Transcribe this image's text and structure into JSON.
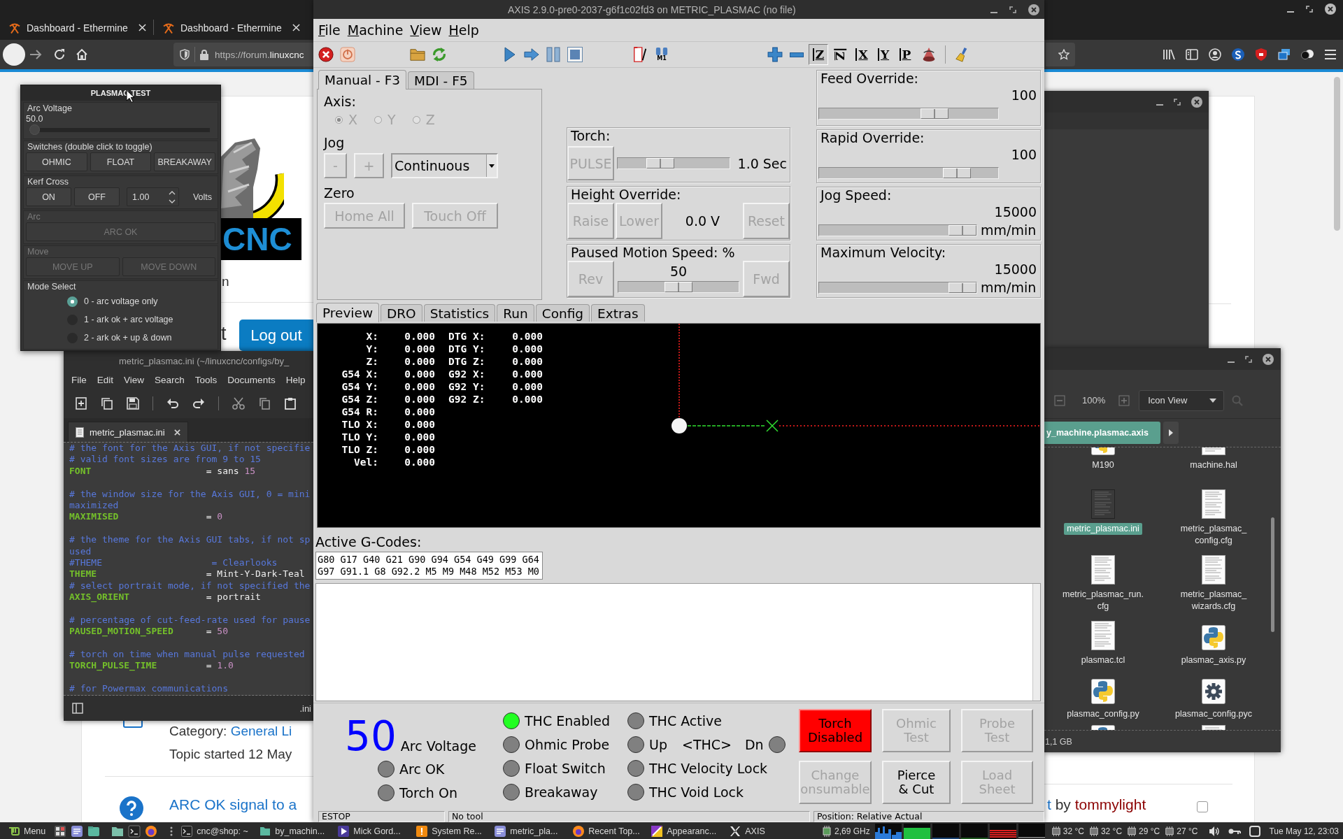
{
  "browser": {
    "tabs": [
      {
        "title": "Dashboard - Ethermine",
        "selected": false
      },
      {
        "title": "Dashboard - Ethermine",
        "selected": false
      }
    ],
    "url": {
      "prefix": "https://forum.",
      "domain": "linuxcnc"
    },
    "page": {
      "logo_text": "CNC",
      "fragment_upper": "n",
      "fragment_lower": "t",
      "logout": "Log out",
      "category_label": "Category:",
      "category_link": "General Li",
      "topic_started": "Topic started 12 May",
      "topic_link": "ARC OK signal to a",
      "author_link_end": "t",
      "author_by": "by",
      "author": "tommylight",
      "topic_checkbox": {
        "checked": false
      }
    }
  },
  "plasmac_test": {
    "title": "PLASMAC TEST",
    "groups": [
      {
        "kind": "slider",
        "label": "Arc Voltage",
        "disabled": false,
        "value": "50.0",
        "level": 0
      },
      {
        "kind": "buttons",
        "label": "Switches (double click to toggle)",
        "disabled": false,
        "buttons": [
          "OHMIC",
          "FLOAT",
          "BREAKAWAY"
        ]
      },
      {
        "kind": "spin",
        "label": "Kerf Cross",
        "disabled": false,
        "buttons": [
          "ON",
          "OFF"
        ],
        "value": "1.00",
        "unit": "Volts"
      },
      {
        "kind": "buttons",
        "label": "Arc",
        "disabled": true,
        "buttons": [
          "ARC OK"
        ]
      },
      {
        "kind": "buttons",
        "label": "Move",
        "disabled": true,
        "buttons": [
          "MOVE UP",
          "MOVE DOWN"
        ]
      },
      {
        "kind": "radios",
        "label": "Mode Select",
        "disabled": false,
        "options": [
          {
            "label": "0 - arc voltage only",
            "selected": true
          },
          {
            "label": "1 - ark ok + arc voltage",
            "selected": false
          },
          {
            "label": "2 - ark ok + up & down",
            "selected": false
          }
        ]
      }
    ]
  },
  "editor": {
    "title": "metric_plasmac.ini (~/linuxcnc/configs/by_",
    "menu": [
      "File",
      "Edit",
      "View",
      "Search",
      "Tools",
      "Documents",
      "Help"
    ],
    "tab": "metric_plasmac.ini",
    "lines": [
      {
        "kind": "comment",
        "text": "# the font for the Axis GUI, if not specifie"
      },
      {
        "kind": "comment",
        "text": "# valid font sizes are from 9 to 15"
      },
      {
        "kind": "setting",
        "key": "FONT",
        "tokens": [
          {
            "kind": "operator",
            "text": "="
          },
          {
            "kind": "string",
            "text": "sans"
          },
          {
            "kind": "number",
            "text": "15"
          }
        ]
      },
      {
        "kind": "blank"
      },
      {
        "kind": "comment",
        "text": "# the window size for the Axis GUI, 0 = mini"
      },
      {
        "kind": "comment",
        "text": "maximized"
      },
      {
        "kind": "setting",
        "key": "MAXIMISED",
        "tokens": [
          {
            "kind": "operator",
            "text": "="
          },
          {
            "kind": "number",
            "text": "0"
          }
        ]
      },
      {
        "kind": "blank"
      },
      {
        "kind": "comment",
        "text": "# the theme for the Axis GUI tabs, if not sp"
      },
      {
        "kind": "comment",
        "text": "used"
      },
      {
        "kind": "comment",
        "text": "#THEME                    = Clearlooks"
      },
      {
        "kind": "setting",
        "key": "THEME",
        "tokens": [
          {
            "kind": "operator",
            "text": "="
          },
          {
            "kind": "string",
            "text": "Mint-Y-Dark-Teal"
          }
        ]
      },
      {
        "kind": "comment",
        "text": "# select portrait mode, if not specified the"
      },
      {
        "kind": "setting",
        "key": "AXIS_ORIENT",
        "tokens": [
          {
            "kind": "operator",
            "text": "="
          },
          {
            "kind": "string",
            "text": "portrait"
          }
        ]
      },
      {
        "kind": "blank"
      },
      {
        "kind": "comment",
        "text": "# percentage of cut-feed-rate used for pause"
      },
      {
        "kind": "setting",
        "key": "PAUSED_MOTION_SPEED",
        "tokens": [
          {
            "kind": "operator",
            "text": "="
          },
          {
            "kind": "number",
            "text": "50"
          }
        ]
      },
      {
        "kind": "blank"
      },
      {
        "kind": "comment",
        "text": "# torch on time when manual pulse requested"
      },
      {
        "kind": "setting",
        "key": "TORCH_PULSE_TIME",
        "tokens": [
          {
            "kind": "operator",
            "text": "="
          },
          {
            "kind": "number",
            "text": "1.0"
          }
        ]
      },
      {
        "kind": "blank"
      },
      {
        "kind": "comment",
        "text": "# for Powermax communications"
      }
    ],
    "status": ".ini"
  },
  "file_manager": {
    "zoom": "100%",
    "view_mode": "Icon View",
    "path": "y_machine.plasmac.axis",
    "files_cut_above": [
      {
        "name_lines": [
          "M190"
        ],
        "kind": "python"
      },
      {
        "name_lines": [
          "machine.hal"
        ],
        "kind": "text"
      }
    ],
    "files": [
      {
        "name_lines": [
          "metric_plasmac.ini"
        ],
        "kind": "text",
        "selected": true
      },
      {
        "name_lines": [
          "metric_plasmac_",
          "config.cfg"
        ],
        "kind": "text",
        "selected": false
      },
      {
        "name_lines": [
          "metric_plasmac_run.",
          "cfg"
        ],
        "kind": "text",
        "selected": false
      },
      {
        "name_lines": [
          "metric_plasmac_",
          "wizards.cfg"
        ],
        "kind": "text",
        "selected": false
      },
      {
        "name_lines": [
          "plasmac.tcl"
        ],
        "kind": "text",
        "selected": false
      },
      {
        "name_lines": [
          "plasmac_axis.py"
        ],
        "kind": "python",
        "selected": false
      },
      {
        "name_lines": [
          "plasmac_config.py"
        ],
        "kind": "python",
        "selected": false
      },
      {
        "name_lines": [
          "plasmac_config.pyc"
        ],
        "kind": "gear",
        "selected": false
      }
    ],
    "files_cut_below": [
      {
        "kind": "python"
      },
      {
        "kind": "text"
      }
    ],
    "status": "1,1 GB"
  },
  "axis": {
    "title": "AXIS 2.9.0-pre0-2037-g6f1c02fd3 on METRIC_PLASMAC (no file)",
    "menu": [
      "File",
      "Machine",
      "View",
      "Help"
    ],
    "toolbar": [
      {
        "kind": "estop",
        "pressed": false
      },
      {
        "kind": "power",
        "pressed": false
      },
      {
        "kind": "open",
        "pressed": false
      },
      {
        "kind": "reload",
        "pressed": false
      },
      {
        "kind": "run",
        "pressed": false
      },
      {
        "kind": "step",
        "pressed": false
      },
      {
        "kind": "pause",
        "pressed": false
      },
      {
        "kind": "stop",
        "pressed": false
      },
      {
        "kind": "block-delete",
        "pressed": false
      },
      {
        "kind": "optional-stop",
        "pressed": false,
        "text": "M1"
      },
      {
        "kind": "zoom-in",
        "pressed": false
      },
      {
        "kind": "zoom-out",
        "pressed": false
      },
      {
        "kind": "view",
        "text": "Z",
        "pressed": true
      },
      {
        "kind": "view-rotated",
        "text": "Z",
        "pressed": false
      },
      {
        "kind": "view",
        "text": "X",
        "pressed": false
      },
      {
        "kind": "view",
        "text": "Y",
        "pressed": false
      },
      {
        "kind": "view",
        "text": "P",
        "pressed": false
      },
      {
        "kind": "rotate",
        "pressed": false
      },
      {
        "kind": "clear",
        "pressed": false
      }
    ],
    "control_tabs": [
      {
        "label": "Manual - F3",
        "selected": true
      },
      {
        "label": "MDI - F5",
        "selected": false
      }
    ],
    "axis_label": "Axis:",
    "axes_disabled": true,
    "axes": [
      {
        "label": "X",
        "selected": true
      },
      {
        "label": "Y",
        "selected": false
      },
      {
        "label": "Z",
        "selected": false
      }
    ],
    "jog_label": "Jog",
    "jog_buttons": [
      {
        "label": "-",
        "disabled": true
      },
      {
        "label": "+",
        "disabled": true
      }
    ],
    "jog_mode": "Continuous",
    "zero_label": "Zero",
    "zero_buttons": [
      {
        "label": "Home All",
        "disabled": true
      },
      {
        "label": "Touch Off",
        "disabled": true
      }
    ],
    "torch": {
      "title": "Torch:",
      "button": {
        "label": "PULSE",
        "disabled": true
      },
      "level": 0.34,
      "reading": "1.0 Sec"
    },
    "height_override": {
      "title": "Height Override:",
      "buttons": [
        {
          "label": "Raise",
          "disabled": true
        },
        {
          "label": "Lower",
          "disabled": true
        }
      ],
      "reading": "0.0 V",
      "reset": {
        "label": "Reset",
        "disabled": true
      }
    },
    "paused_motion": {
      "title": "Paused Motion Speed: %",
      "rev": {
        "label": "Rev",
        "disabled": true
      },
      "reading": "50",
      "level": 0.5,
      "fwd": {
        "label": "Fwd",
        "disabled": true
      }
    },
    "overrides": [
      {
        "title": "Feed Override:",
        "reading": "100",
        "level": 0.67
      },
      {
        "title": "Rapid Override:",
        "reading": "100",
        "level": 0.82
      },
      {
        "title": "Jog Speed:",
        "reading": "15000",
        "unit": "mm/min",
        "level": 1
      },
      {
        "title": "Maximum Velocity:",
        "reading": "15000",
        "unit": "mm/min",
        "level": 1
      }
    ],
    "view_tabs": [
      {
        "label": "Preview",
        "selected": true
      },
      {
        "label": "DRO",
        "selected": false
      },
      {
        "label": "Statistics",
        "selected": false
      },
      {
        "label": "Run",
        "selected": false
      },
      {
        "label": "Config",
        "selected": false
      },
      {
        "label": "Extras",
        "selected": false
      }
    ],
    "dro": [
      [
        "X:",
        "0.000",
        "DTG X:",
        "0.000"
      ],
      [
        "Y:",
        "0.000",
        "DTG Y:",
        "0.000"
      ],
      [
        "Z:",
        "0.000",
        "DTG Z:",
        "0.000"
      ],
      [
        "G54 X:",
        "0.000",
        "G92 X:",
        "0.000"
      ],
      [
        "G54 Y:",
        "0.000",
        "G92 Y:",
        "0.000"
      ],
      [
        "G54 Z:",
        "0.000",
        "G92 Z:",
        "0.000"
      ],
      [
        "G54 R:",
        "0.000"
      ],
      [
        "TLO X:",
        "0.000"
      ],
      [
        "TLO Y:",
        "0.000"
      ],
      [
        "TLO Z:",
        "0.000"
      ],
      [
        "Vel:",
        "0.000"
      ]
    ],
    "gcodes_label": "Active G-Codes:",
    "gcodes": [
      "G80 G17 G40 G21 G90 G94 G54 G49 G99 G64",
      "G97 G91.1 G8 G92.2 M5 M9 M48 M52 M53 M0"
    ],
    "arc_voltage": "50",
    "arc_voltage_label": "Arc Voltage",
    "arc_leds": [
      {
        "kind": "led",
        "label": "Arc OK",
        "on": false
      },
      {
        "kind": "led",
        "label": "Torch On",
        "on": false
      }
    ],
    "led_columns": [
      [
        {
          "kind": "led",
          "label": "THC Enabled",
          "on": true
        },
        {
          "kind": "led",
          "label": "Ohmic Probe",
          "on": false
        },
        {
          "kind": "led",
          "label": "Float Switch",
          "on": false
        },
        {
          "kind": "led",
          "label": "Breakaway",
          "on": false
        }
      ],
      [
        {
          "kind": "led",
          "label": "THC Active",
          "on": false
        },
        {
          "kind": "updown",
          "up": "Up",
          "middle": "<THC>",
          "down": "Dn",
          "up_on": false,
          "down_on": false
        },
        {
          "kind": "led",
          "label": "THC Velocity Lock",
          "on": false
        },
        {
          "kind": "led",
          "label": "THC Void Lock",
          "on": false
        }
      ]
    ],
    "buttons": [
      {
        "lines": [
          "Torch",
          "Disabled"
        ],
        "kind": "alert",
        "disabled": false
      },
      {
        "lines": [
          "Ohmic",
          "Test"
        ],
        "kind": "normal",
        "disabled": true
      },
      {
        "lines": [
          "Probe",
          "Test"
        ],
        "kind": "normal",
        "disabled": true
      },
      {
        "lines": [
          "Change",
          "onsumable"
        ],
        "kind": "normal",
        "disabled": true
      },
      {
        "lines": [
          "Pierce",
          "& Cut"
        ],
        "kind": "normal",
        "disabled": false
      },
      {
        "lines": [
          "Load",
          "Sheet"
        ],
        "kind": "normal",
        "disabled": true
      }
    ],
    "status": [
      "ESTOP",
      "No tool",
      "Position: Relative Actual"
    ]
  },
  "taskbar": {
    "menu": "Menu",
    "windows": [
      {
        "label": "cnc@shop: ~",
        "kind": "terminal"
      },
      {
        "label": "by_machin...",
        "kind": "folder"
      },
      {
        "label": "Mick Gord...",
        "kind": "video"
      },
      {
        "label": "System Re...",
        "kind": "monitor"
      },
      {
        "label": "metric_pla...",
        "kind": "editor"
      },
      {
        "label": "Recent Top...",
        "kind": "browser"
      },
      {
        "label": "Appearanc...",
        "kind": "appearance"
      },
      {
        "label": "AXIS",
        "kind": "x"
      }
    ],
    "cpu": "2,69 GHz",
    "temperatures": [
      "32 °C",
      "32 °C",
      "29 °C",
      "27 °C"
    ],
    "clock": "Tue May 12, 23:03"
  }
}
